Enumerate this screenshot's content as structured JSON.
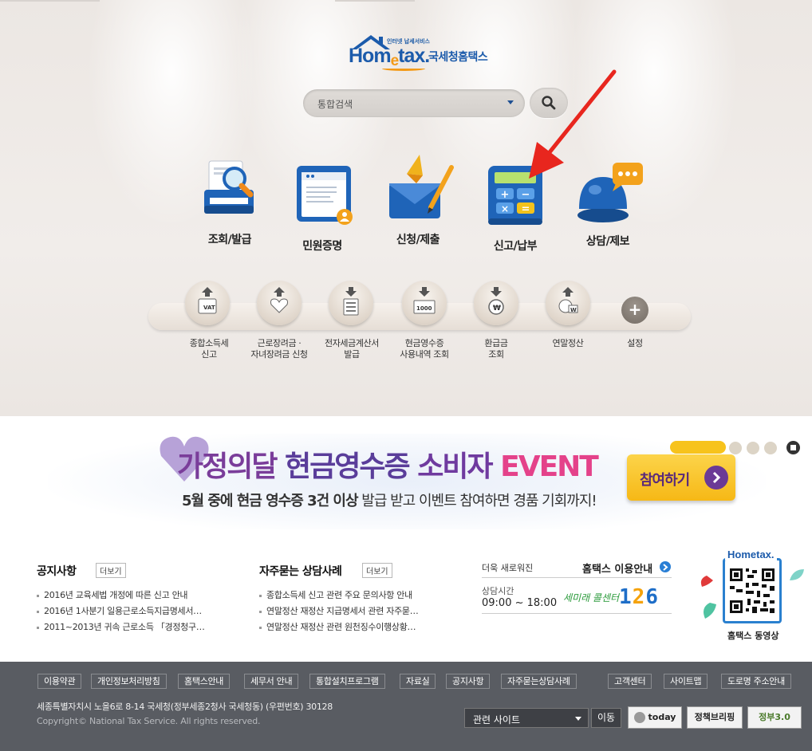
{
  "logo": {
    "tagline": "인터넷 납세서비스",
    "brand_pre": "Hom",
    "brand_e": "e",
    "brand_post": "tax.",
    "korean": "국세청홈택스"
  },
  "search": {
    "scope_label": "통합검색",
    "icon": "search-icon"
  },
  "main_menu": [
    {
      "label": "조회/발급",
      "icon": "magnifier-document-icon"
    },
    {
      "label": "민원증명",
      "icon": "certificate-icon"
    },
    {
      "label": "신청/제출",
      "icon": "envelope-pen-icon"
    },
    {
      "label": "신고/납부",
      "icon": "calculator-icon"
    },
    {
      "label": "상담/제보",
      "icon": "chat-bubble-icon"
    }
  ],
  "quick_menu": [
    {
      "label_1": "종합소득세",
      "label_2": "신고",
      "icon": "vat-upload-icon"
    },
    {
      "label_1": "근로장려금 ·",
      "label_2": "자녀장려금 신청",
      "icon": "heart-upload-icon"
    },
    {
      "label_1": "전자세금계산서",
      "label_2": "발급",
      "icon": "invoice-download-icon"
    },
    {
      "label_1": "현금영수증",
      "label_2": "사용내역 조회",
      "icon": "receipt-download-icon"
    },
    {
      "label_1": "환급금",
      "label_2": "조회",
      "icon": "refund-download-icon"
    },
    {
      "label_1": "연말정산",
      "label_2": "",
      "icon": "yearend-upload-icon"
    }
  ],
  "quick_settings": {
    "label": "설정",
    "icon": "plus-icon"
  },
  "banner": {
    "title_1": "가정의달",
    "title_2": "현금영수증",
    "title_3": "소비자",
    "title_4": "EVENT",
    "sub_bold": "5월 중에 현금 영수증 3건 이상",
    "sub_rest": " 발급 받고 이벤트 참여하면 경품 기회까지!",
    "join_label": "참여하기",
    "colors": {
      "accent": "#f7c31c",
      "purple": "#6b3a96",
      "pink": "#e4428a"
    }
  },
  "notice": {
    "title": "공지사항",
    "more": "더보기",
    "items": [
      "2016년 교육세법 개정에 따른 신고 안내",
      "2016년 1사분기 일용근로소득지급명세서…",
      "2011~2013년 귀속 근로소득 「경정청구…"
    ]
  },
  "faq": {
    "title": "자주묻는 상담사례",
    "more": "더보기",
    "items": [
      "종합소득세 신고 관련 주요 문의사항 안내",
      "연말정산 재정산 지급명세서 관련 자주묻…",
      "연말정산 재정산 관련 원천징수이행상황…"
    ]
  },
  "service": {
    "new_label": "더욱 새로워진",
    "guide_label": "홈택스 이용안내",
    "hours_label": "상담시간",
    "hours": "09:00 ~ 18:00",
    "callcenter": "세미래 콜센터",
    "number_a": "1",
    "number_b": "2",
    "number_c": "6"
  },
  "qr": {
    "logo": "Hometax.",
    "caption": "홈택스 동영상"
  },
  "footer": {
    "links": [
      "이용약관",
      "개인정보처리방침",
      "홈택스안내",
      "세무서 안내",
      "통합설치프로그램",
      "자료실",
      "공지사항",
      "자주묻는상담사례"
    ],
    "right_links": [
      "고객센터",
      "사이트맵",
      "도로명 주소안내"
    ],
    "address": "세종특별자치시 노을6로 8-14 국세청(정부세종2청사 국세청동) (우편번호) 30128",
    "copyright": "Copyright© National Tax Service. All rights reserved.",
    "related_sites": "관련 사이트",
    "go": "이동",
    "badge_1": "today",
    "badge_2": "정책브리핑",
    "badge_3": "정부3.0"
  }
}
